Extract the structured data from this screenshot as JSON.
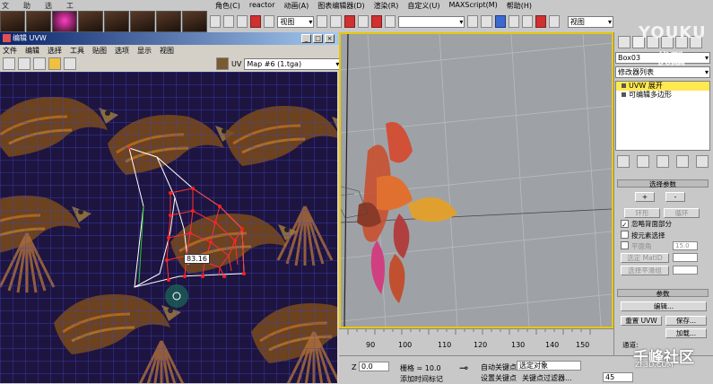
{
  "top_left_menu": [
    "文",
    "助",
    "选",
    "工"
  ],
  "main_menu": [
    "角色(C)",
    "reactor",
    "动画(A)",
    "图表编辑器(D)",
    "渲染(R)",
    "自定义(U)",
    "MAXScript(M)",
    "帮助(H)"
  ],
  "toolbar": {
    "view_combo": "视图",
    "right_view_combo": "视图"
  },
  "uvw_window": {
    "title": "编辑 UVW",
    "menu": [
      "文件",
      "编辑",
      "选择",
      "工具",
      "贴图",
      "选项",
      "显示",
      "视图"
    ],
    "uv_label": "UV",
    "map_combo": "Map #6 (1.tga)",
    "vertex_readout": "83.16"
  },
  "timeline": {
    "ticks": [
      "90",
      "100",
      "110",
      "120",
      "130",
      "140",
      "150"
    ]
  },
  "command_panel": {
    "object_name": "Box03",
    "modifier_list": "修改器列表",
    "stack": [
      "UVW 展开",
      "可编辑多边形"
    ],
    "selection_rollout": {
      "title": "选择参数",
      "plus": "+",
      "minus": "-",
      "ring": "环形",
      "loop": "循环",
      "ignore_backfacing": "忽略背面部分",
      "select_by_element": "按元素选择",
      "planar_angle": "平面角",
      "planar_value": "15.0",
      "select_matid": "选定 MatID",
      "select_smoothing": "选择平滑组"
    },
    "params_rollout": {
      "title": "参数",
      "edit": "编辑...",
      "reset_uvw": "重置 UVW",
      "save": "保存...",
      "load": "加载..."
    }
  },
  "bottom_bar": {
    "z_label": "Z",
    "z_value": "0.0",
    "grid_label": "栅格 = 10.0",
    "auto_key": "自动关键点",
    "selected_object": "选定对象",
    "set_key": "设置关键点",
    "key_filters": "关键点过滤器...",
    "add_time_tag": "添加时间标记",
    "frame_value": "45",
    "channel_label": "通道:"
  },
  "watermarks": {
    "youku": "YOUKU",
    "youku_cn": "优酷",
    "qf": "千峰社区",
    "qf_url": "ZF3D.COM"
  },
  "colors": {
    "title_bar": "#0a246a",
    "viewport_border": "#e8c800",
    "uv_bg": "#1e1440",
    "uv_grid": "#3a48c8",
    "uv_selected": "#ff2020"
  }
}
